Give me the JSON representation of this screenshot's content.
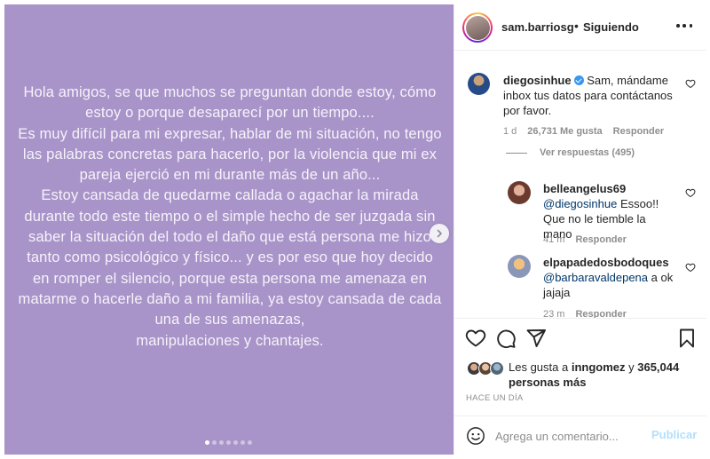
{
  "post": {
    "story_paragraphs": [
      "Hola amigos, se que muchos se preguntan donde estoy, cómo estoy o porque desaparecí por un tiempo....",
      "Es muy difícil para mi expresar, hablar de mi situación, no tengo las palabras concretas para hacerlo, por la violencia que mi ex pareja ejerció en mi durante más de un año...",
      "Estoy cansada de quedarme callada o agachar la mirada durante todo este tiempo o el simple hecho de ser juzgada sin saber la situación del todo el daño que está persona me hizo tanto como psicológico y físico... y es por eso que hoy decido en romper el silencio, porque esta persona me amenaza en matarme o hacerle daño a mi familia, ya estoy cansada de cada una de sus amenazas,",
      "manipulaciones y chantajes."
    ],
    "background_color": "#a894c8",
    "carousel_total": 7,
    "carousel_active_index": 0,
    "next_icon": "chevron-right-icon"
  },
  "header": {
    "username": "sam.barriosg",
    "separator": "•",
    "follow_status": "Siguiendo",
    "more_icon": "more-horizontal-icon"
  },
  "comments": [
    {
      "username": "diegosinhue",
      "verified": true,
      "text": "Sam, mándame inbox tus datos para contáctanos por favor.",
      "time": "1 d",
      "likes": "26,731 Me gusta",
      "reply_label": "Responder"
    }
  ],
  "view_replies": "Ver respuestas (495)",
  "replies": [
    {
      "username": "belleangelus69",
      "mention": "@diegosinhue",
      "text": " Essoo!! Que no le tiemble la mano",
      "time": "41 m",
      "reply_label": "Responder"
    },
    {
      "username": "elpapadedosbodoques",
      "mention": "@barbaravaldepena",
      "text": " a ok jajaja",
      "time": "23 m",
      "reply_label": "Responder"
    }
  ],
  "actions": {
    "like_icon": "heart-icon",
    "comment_icon": "comment-icon",
    "share_icon": "send-icon",
    "save_icon": "bookmark-icon"
  },
  "likes": {
    "prefix": "Les gusta a ",
    "user": "inngomez",
    "middle": " y ",
    "others": "365,044 personas más"
  },
  "timestamp": "HACE UN DÍA",
  "comment_bar": {
    "emoji_icon": "emoji-icon",
    "placeholder": "Agrega un comentario...",
    "publish_label": "Publicar"
  }
}
